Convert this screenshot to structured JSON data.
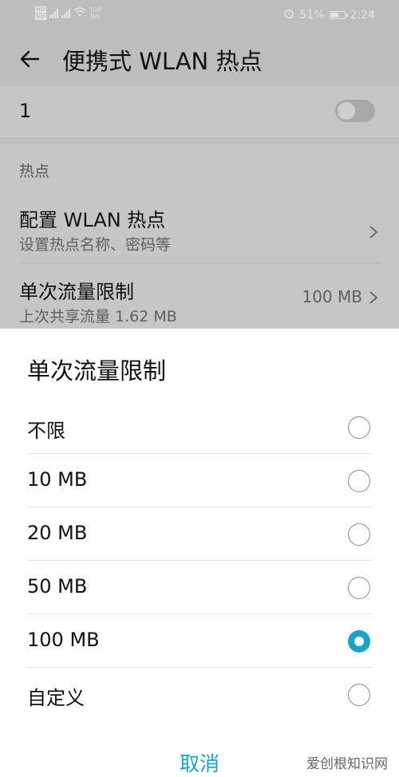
{
  "status_bar": {
    "net_speed_value": "100",
    "net_speed_unit": "B/s",
    "battery": "51%",
    "time": "2:24"
  },
  "header": {
    "title": "便携式 WLAN 热点"
  },
  "hotspot_toggle": {
    "label": "1",
    "on": false
  },
  "section": {
    "header": "热点",
    "items": [
      {
        "title": "配置 WLAN 热点",
        "subtitle": "设置热点名称、密码等",
        "value": ""
      },
      {
        "title": "单次流量限制",
        "subtitle": "上次共享流量 1.62 MB",
        "value": "100 MB"
      }
    ]
  },
  "dialog": {
    "title": "单次流量限制",
    "options": [
      {
        "label": "不限",
        "selected": false
      },
      {
        "label": "10 MB",
        "selected": false
      },
      {
        "label": "20 MB",
        "selected": false
      },
      {
        "label": "50 MB",
        "selected": false
      },
      {
        "label": "100 MB",
        "selected": true
      },
      {
        "label": "自定义",
        "selected": false
      }
    ],
    "cancel_label": "取消"
  },
  "watermark": "爱创根知识网",
  "colors": {
    "accent": "#1aa3c8",
    "dim_background": "#bdbdbd"
  }
}
